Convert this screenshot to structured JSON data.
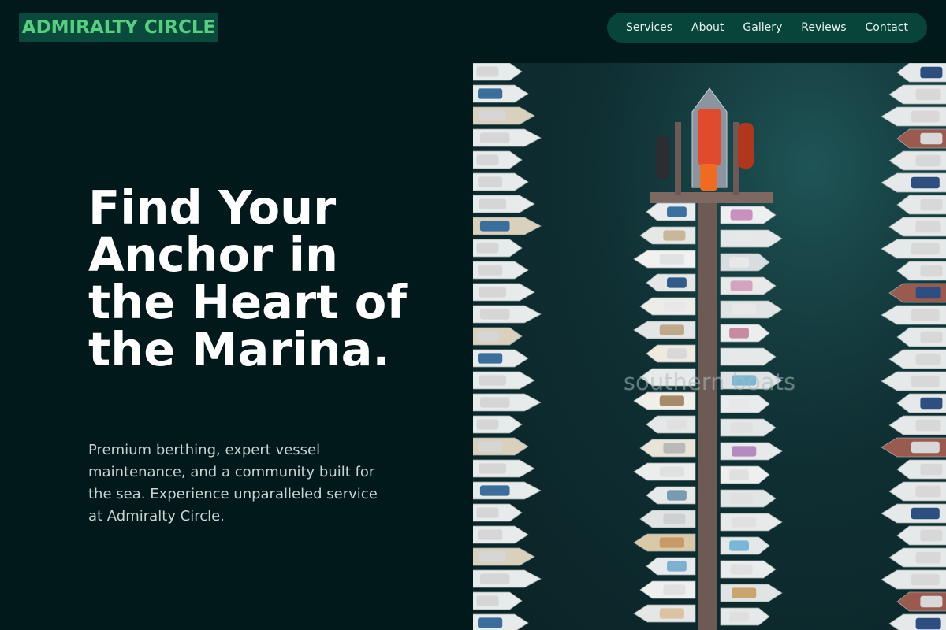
{
  "brand": {
    "name": "ADMIRALTY CIRCLE",
    "color": "#55d07f",
    "bg": "#0a4a3c"
  },
  "nav": {
    "items": [
      {
        "label": "Services"
      },
      {
        "label": "About"
      },
      {
        "label": "Gallery"
      },
      {
        "label": "Reviews"
      },
      {
        "label": "Contact"
      }
    ]
  },
  "hero": {
    "title": "Find Your Anchor in the Heart of the Marina.",
    "subtitle": "Premium berthing, expert vessel maintenance, and a community built for the sea. Experience unparalleled service at Admiralty Circle.",
    "image": {
      "subject": "aerial-marina-photo",
      "watermark": "southern boats"
    }
  },
  "colors": {
    "page_bg": "#02191b",
    "nav_bg": "#07443a",
    "water": "#0f2f33",
    "pier": "#6e5a55"
  }
}
